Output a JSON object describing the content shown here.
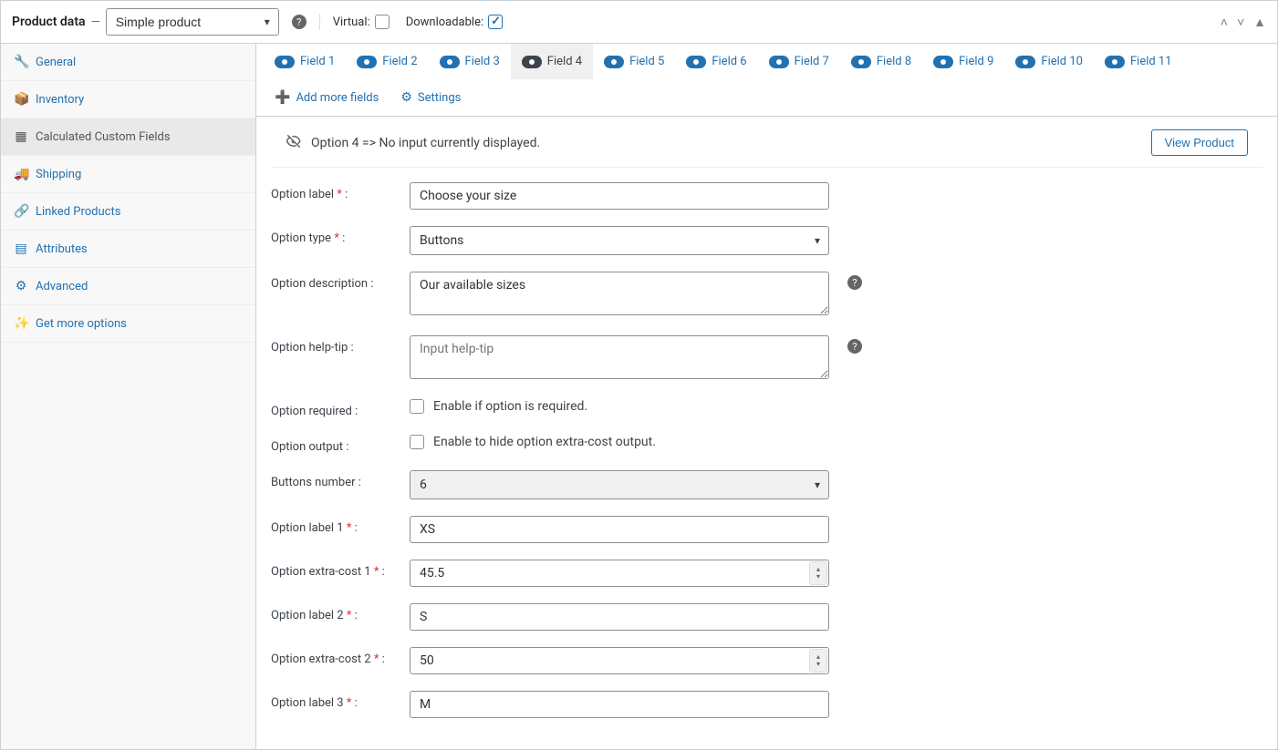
{
  "header": {
    "title": "Product data",
    "product_type": "Simple product",
    "virtual_label": "Virtual:",
    "virtual_checked": false,
    "downloadable_label": "Downloadable:",
    "downloadable_checked": true
  },
  "sidebar": {
    "items": [
      {
        "label": "General",
        "icon": "🔧"
      },
      {
        "label": "Inventory",
        "icon": "📦"
      },
      {
        "label": "Calculated Custom Fields",
        "icon": "▦",
        "active": true
      },
      {
        "label": "Shipping",
        "icon": "🚚"
      },
      {
        "label": "Linked Products",
        "icon": "🔗"
      },
      {
        "label": "Attributes",
        "icon": "▤"
      },
      {
        "label": "Advanced",
        "icon": "⚙"
      },
      {
        "label": "Get more options",
        "icon": "✨"
      }
    ]
  },
  "tabs": {
    "fields": [
      "Field 1",
      "Field 2",
      "Field 3",
      "Field 4",
      "Field 5",
      "Field 6",
      "Field 7",
      "Field 8",
      "Field 9",
      "Field 10",
      "Field 11"
    ],
    "active_index": 3,
    "add_more": "Add more fields",
    "settings": "Settings"
  },
  "notice": {
    "text": "Option 4 => No input currently displayed.",
    "view_product": "View Product"
  },
  "form": {
    "option_label": {
      "label": "Option label",
      "value": "Choose your size"
    },
    "option_type": {
      "label": "Option type",
      "value": "Buttons"
    },
    "option_desc": {
      "label": "Option description :",
      "value": "Our available sizes"
    },
    "option_help": {
      "label": "Option help-tip :",
      "placeholder": "Input help-tip"
    },
    "option_required": {
      "label": "Option required :",
      "text": "Enable if option is required."
    },
    "option_output": {
      "label": "Option output :",
      "text": "Enable to hide option extra-cost output."
    },
    "buttons_number": {
      "label": "Buttons number :",
      "value": "6"
    },
    "label1": {
      "label": "Option label 1",
      "value": "XS"
    },
    "cost1": {
      "label": "Option extra-cost 1",
      "value": "45.5"
    },
    "label2": {
      "label": "Option label 2",
      "value": "S"
    },
    "cost2": {
      "label": "Option extra-cost 2",
      "value": "50"
    },
    "label3": {
      "label": "Option label 3",
      "value": "M"
    }
  }
}
